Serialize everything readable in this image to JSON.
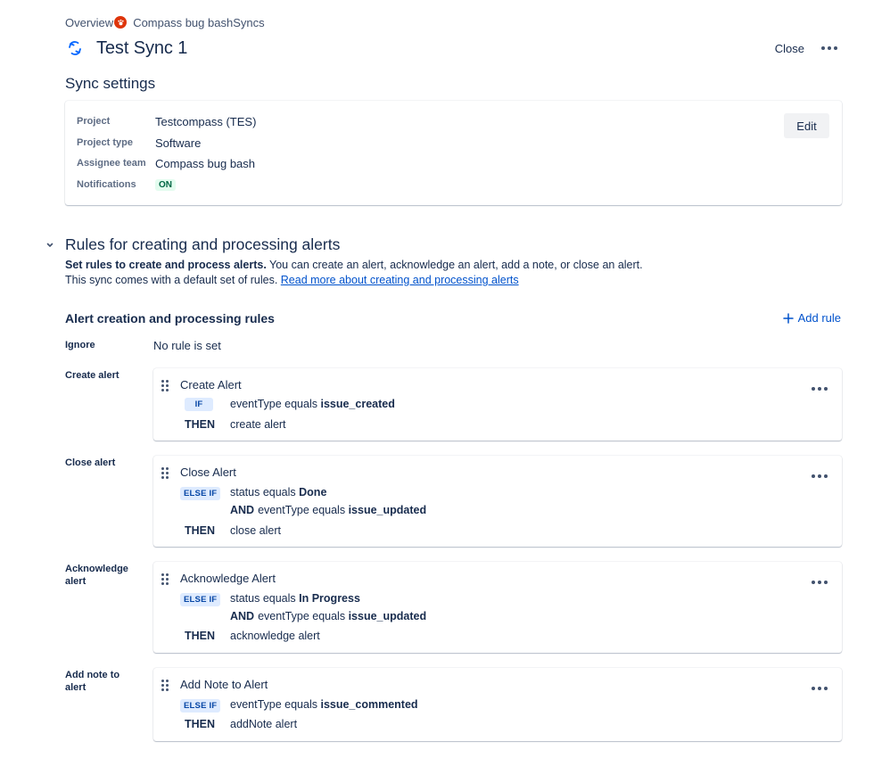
{
  "breadcrumb": {
    "overview": "Overview",
    "team": "Compass bug bash",
    "syncs": "Syncs"
  },
  "header": {
    "title": "Test Sync 1",
    "close_label": "Close"
  },
  "sync_settings": {
    "title": "Sync settings",
    "edit_label": "Edit",
    "rows": [
      {
        "label": "Project",
        "value": "Testcompass (TES)"
      },
      {
        "label": "Project type",
        "value": "Software"
      },
      {
        "label": "Assignee team",
        "value": "Compass bug bash"
      },
      {
        "label": "Notifications",
        "value": "ON"
      }
    ]
  },
  "rules_section": {
    "title": "Rules for creating and processing alerts",
    "desc_bold": "Set rules to create and process alerts.",
    "desc_rest": " You can create an alert, acknowledge an alert, add a note, or close an alert.",
    "desc_line2": "This sync comes with a default set of rules. ",
    "desc_link": "Read more about creating and processing alerts",
    "list_title": "Alert creation and processing rules",
    "add_rule_label": "Add rule",
    "ignore_label": "Ignore",
    "ignore_value": "No rule is set"
  },
  "rules": [
    {
      "label": "Create alert",
      "name": "Create Alert",
      "cond_key": "IF",
      "cond_field": "eventType equals ",
      "cond_value": "issue_created",
      "then_key": "THEN",
      "then_value": "create alert"
    },
    {
      "label": "Close alert",
      "name": "Close Alert",
      "cond_key": "ELSE IF",
      "cond_field": "status equals ",
      "cond_value": "Done",
      "and_key": "AND",
      "and_field": "eventType equals ",
      "and_value": "issue_updated",
      "then_key": "THEN",
      "then_value": "close alert"
    },
    {
      "label": "Acknowledge alert",
      "name": "Acknowledge Alert",
      "cond_key": "ELSE IF",
      "cond_field": "status equals ",
      "cond_value": "In Progress",
      "and_key": "AND",
      "and_field": "eventType equals ",
      "and_value": "issue_updated",
      "then_key": "THEN",
      "then_value": "acknowledge alert"
    },
    {
      "label": "Add note to alert",
      "name": "Add Note to Alert",
      "cond_key": "ELSE IF",
      "cond_field": "eventType equals ",
      "cond_value": "issue_commented",
      "then_key": "THEN",
      "then_value": "addNote alert"
    }
  ],
  "colors": {
    "link": "#0052cc",
    "text": "#172b4d",
    "subtle": "#5e6c84",
    "on_lozenge_bg": "#e3fcef",
    "on_lozenge_text": "#006644",
    "if_lozenge_bg": "#deebff",
    "if_lozenge_text": "#0747a6",
    "brand_logo": "#de350b"
  },
  "icons": {
    "breadcrumb_logo": "team-logo-icon",
    "sync": "sync-icon",
    "more": "more-icon",
    "chevron": "chevron-down-icon",
    "add": "plus-icon",
    "drag": "drag-handle-icon"
  }
}
